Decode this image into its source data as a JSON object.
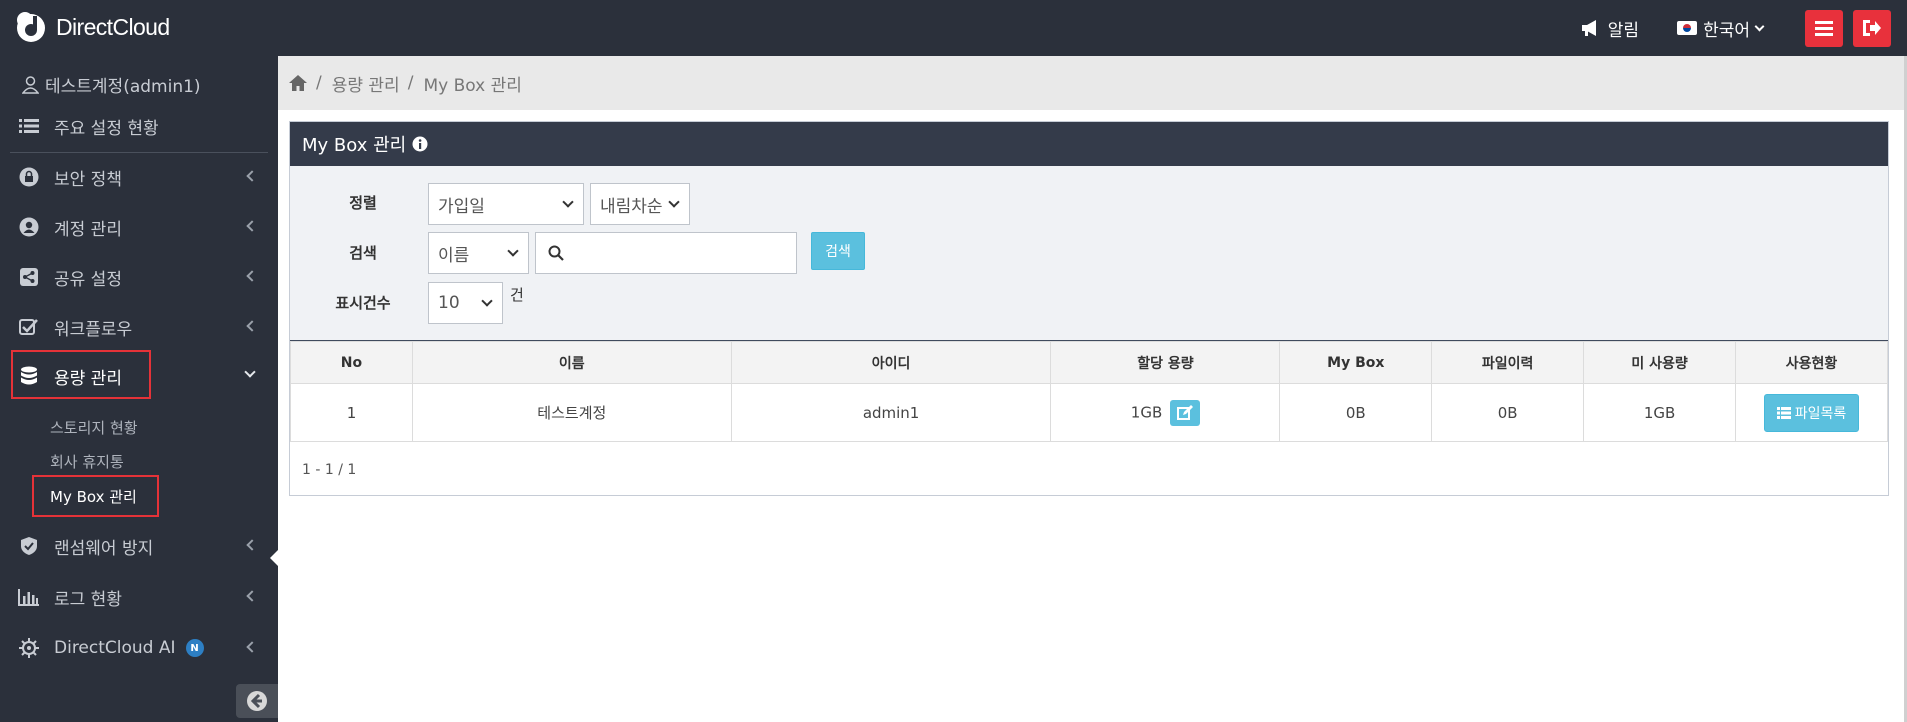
{
  "topbar": {
    "logo_text": "DirectCloud",
    "alert_label": "알림",
    "language_label": "한국어",
    "colors": {
      "bar": "#2b303b",
      "danger": "#e8313c"
    }
  },
  "sidebar": {
    "user_label": "테스트계정(admin1)",
    "items": [
      {
        "label": "주요 설정 현황",
        "icon": "list-icon"
      },
      {
        "label": "보안 정책",
        "icon": "lock-icon"
      },
      {
        "label": "계정 관리",
        "icon": "user-circle-icon"
      },
      {
        "label": "공유 설정",
        "icon": "share-icon"
      },
      {
        "label": "워크플로우",
        "icon": "check-square-icon"
      },
      {
        "label": "용량 관리",
        "icon": "database-icon"
      },
      {
        "label": "랜섬웨어 방지",
        "icon": "shield-icon"
      },
      {
        "label": "로그 현황",
        "icon": "bar-chart-icon"
      },
      {
        "label": "DirectCloud AI",
        "icon": "ai-gear-icon",
        "badge": "N"
      }
    ],
    "sub_items": [
      {
        "label": "스토리지 현황"
      },
      {
        "label": "회사 휴지통"
      },
      {
        "label": "My Box 관리"
      }
    ]
  },
  "breadcrumb": {
    "items": [
      "용량 관리",
      "My Box 관리"
    ],
    "separator": "/"
  },
  "panel": {
    "title": "My Box 관리",
    "sort_label": "정렬",
    "sort_value": "가입일",
    "order_value": "내림차순",
    "search_label": "검색",
    "search_field_value": "이름",
    "search_placeholder": "",
    "search_button": "검색",
    "count_label": "표시건수",
    "count_value": "10",
    "count_unit": "건"
  },
  "table": {
    "headers": [
      "No",
      "이름",
      "아이디",
      "할당 용량",
      "My Box",
      "파일이력",
      "미 사용량",
      "사용현황"
    ],
    "rows": [
      {
        "no": "1",
        "name": "테스트계정",
        "id": "admin1",
        "quota": "1GB",
        "mybox": "0B",
        "history": "0B",
        "unused": "1GB",
        "action": "파일목록"
      }
    ],
    "pagination": "1 - 1 / 1"
  }
}
